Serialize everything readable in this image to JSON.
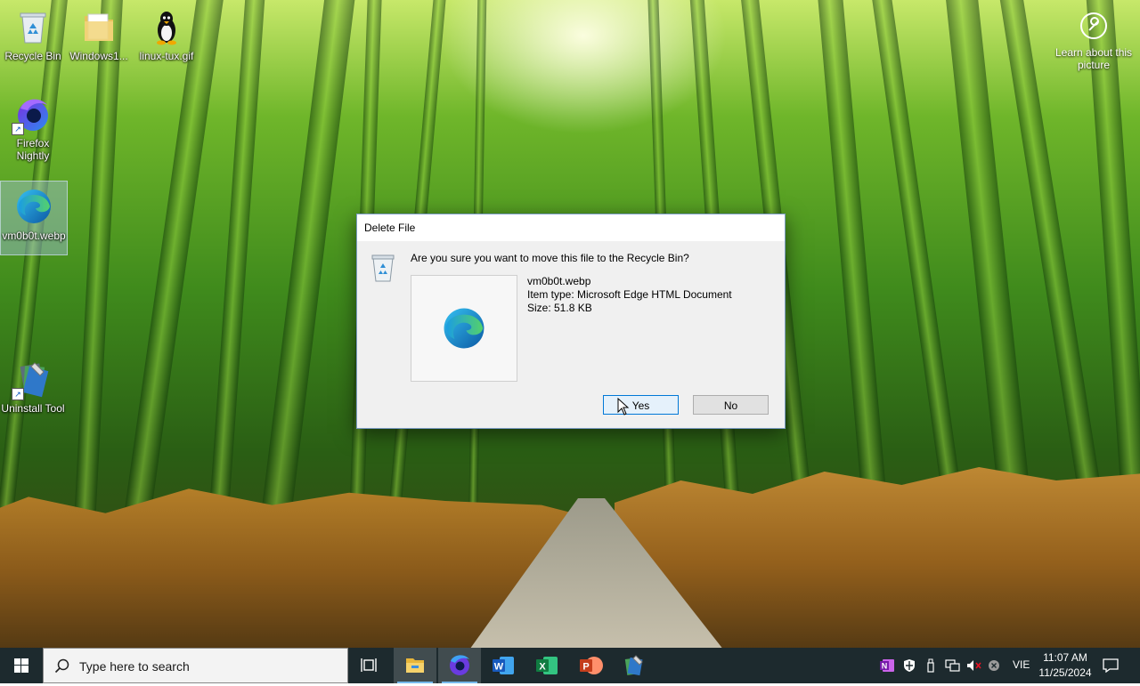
{
  "desktop": {
    "icons": [
      {
        "label": "Recycle Bin"
      },
      {
        "label": "Windows1..."
      },
      {
        "label": "linux-tux.gif"
      },
      {
        "label": "Firefox Nightly"
      },
      {
        "label": "vm0b0t.webp"
      },
      {
        "label": "Uninstall Tool"
      }
    ],
    "learn_about": "Learn about this picture"
  },
  "dialog": {
    "title": "Delete File",
    "question": "Are you sure you want to move this file to the Recycle Bin?",
    "file_name": "vm0b0t.webp",
    "item_type": "Item type: Microsoft Edge HTML Document",
    "size": "Size: 51.8 KB",
    "yes_label": "Yes",
    "no_label": "No"
  },
  "taskbar": {
    "search_placeholder": "Type here to search",
    "apps": [
      "task-view",
      "file-explorer",
      "firefox-nightly",
      "word",
      "excel",
      "powerpoint",
      "uninstall-tool"
    ],
    "language": "VIE",
    "time": "11:07 AM",
    "date": "11/25/2024"
  }
}
